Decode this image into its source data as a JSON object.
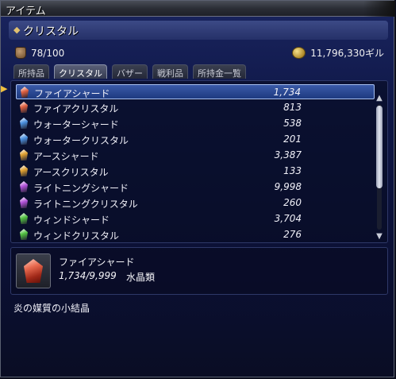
{
  "window": {
    "title": "アイテム"
  },
  "section": {
    "title": "クリスタル"
  },
  "inventory": {
    "capacity": "78/100",
    "gil": "11,796,330ギル"
  },
  "tabs": [
    {
      "label": "所持品",
      "active": false
    },
    {
      "label": "クリスタル",
      "active": true
    },
    {
      "label": "バザー",
      "active": false
    },
    {
      "label": "戦利品",
      "active": false
    },
    {
      "label": "所持金一覧",
      "active": false
    }
  ],
  "items": [
    {
      "name": "ファイアシャード",
      "count": "1,734",
      "color": "#e06040",
      "selected": true
    },
    {
      "name": "ファイアクリスタル",
      "count": "813",
      "color": "#e06040",
      "selected": false
    },
    {
      "name": "ウォーターシャード",
      "count": "538",
      "color": "#4a90e0",
      "selected": false
    },
    {
      "name": "ウォータークリスタル",
      "count": "201",
      "color": "#4a90e0",
      "selected": false
    },
    {
      "name": "アースシャード",
      "count": "3,387",
      "color": "#e0a030",
      "selected": false
    },
    {
      "name": "アースクリスタル",
      "count": "133",
      "color": "#e0a030",
      "selected": false
    },
    {
      "name": "ライトニングシャード",
      "count": "9,998",
      "color": "#b050d8",
      "selected": false
    },
    {
      "name": "ライトニングクリスタル",
      "count": "260",
      "color": "#b050d8",
      "selected": false
    },
    {
      "name": "ウィンドシャード",
      "count": "3,704",
      "color": "#50c040",
      "selected": false
    },
    {
      "name": "ウィンドクリスタル",
      "count": "276",
      "color": "#50c040",
      "selected": false
    }
  ],
  "detail": {
    "name": "ファイアシャード",
    "quantity": "1,734/9,999",
    "category": "水晶類",
    "description": "炎の媒質の小結晶"
  }
}
